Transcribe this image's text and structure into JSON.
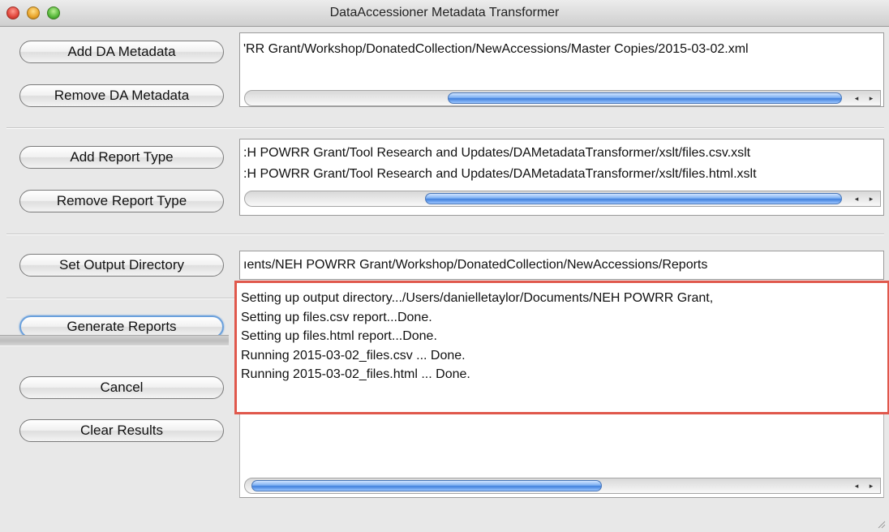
{
  "window": {
    "title": "DataAccessioner Metadata Transformer"
  },
  "buttons": {
    "add_da_metadata": "Add DA Metadata",
    "remove_da_metadata": "Remove DA Metadata",
    "add_report_type": "Add Report Type",
    "remove_report_type": "Remove Report Type",
    "set_output_directory": "Set Output Directory",
    "generate_reports": "Generate Reports",
    "cancel": "Cancel",
    "clear_results": "Clear Results"
  },
  "metadata_files": [
    "'RR Grant/Workshop/DonatedCollection/NewAccessions/Master Copies/2015-03-02.xml"
  ],
  "report_types": [
    ":H POWRR Grant/Tool Research and Updates/DAMetadataTransformer/xslt/files.csv.xslt",
    ":H POWRR Grant/Tool Research and Updates/DAMetadataTransformer/xslt/files.html.xslt"
  ],
  "output_directory": "ıents/NEH POWRR Grant/Workshop/DonatedCollection/NewAccessions/Reports",
  "log_lines": [
    "Setting up output directory.../Users/danielletaylor/Documents/NEH POWRR Grant,",
    "Setting up files.csv report...Done.",
    "Setting up files.html report...Done.",
    "Running 2015-03-02_files.csv ... Done.",
    "Running 2015-03-02_files.html ... Done."
  ],
  "icons": {
    "scroll_left": "◂",
    "scroll_right": "▸",
    "resize": "resize-grip-icon"
  },
  "colors": {
    "highlight_border": "#e0584c",
    "scroll_thumb": "#3f7fdc",
    "default_button_ring": "#6aa0dc"
  }
}
